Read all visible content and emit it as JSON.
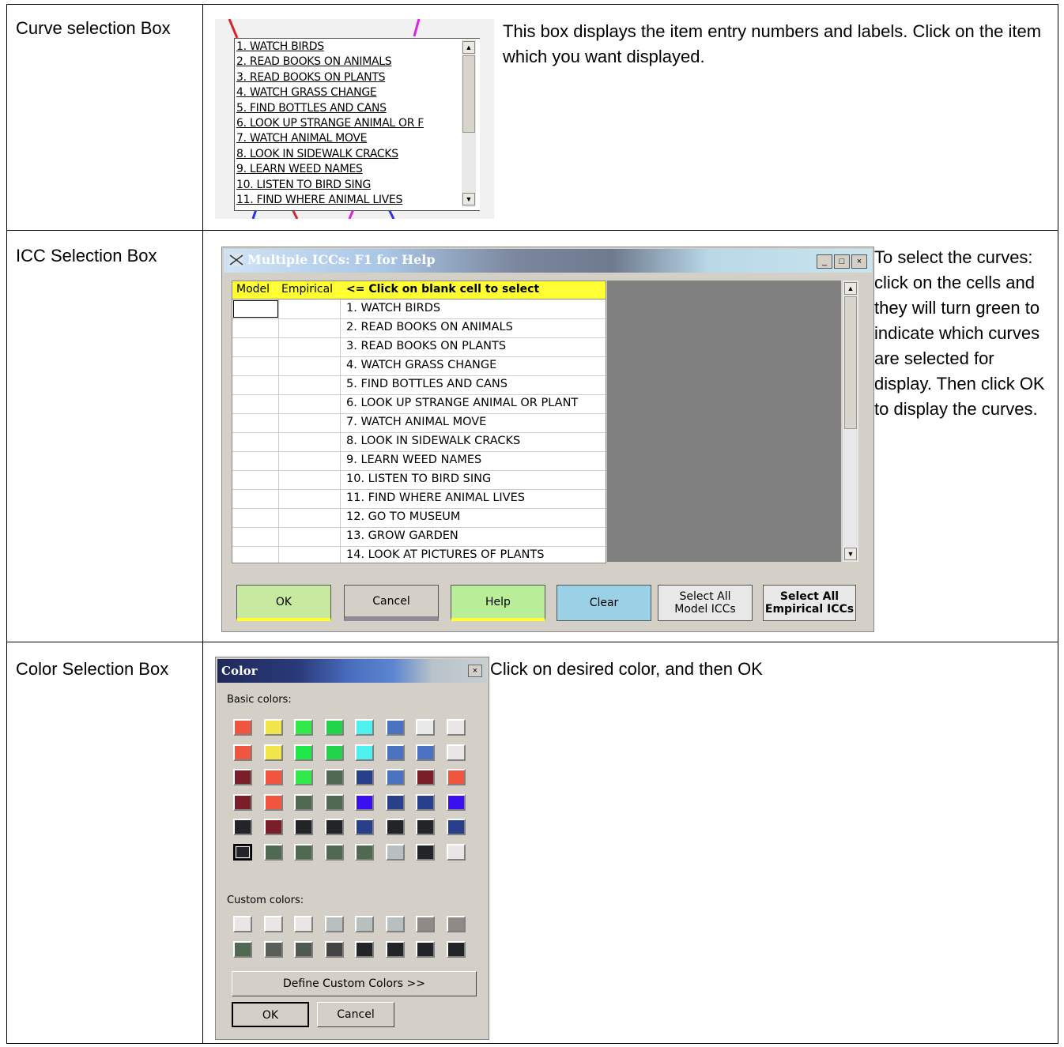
{
  "rows": [
    {
      "label": "Curve selection Box",
      "description": "This box displays the item entry numbers and labels. Click on the item which you want displayed."
    },
    {
      "label": "ICC Selection Box",
      "description": "To select the curves: click on the cells and they will turn green to indicate which curves are selected for display. Then click OK to display the curves."
    },
    {
      "label": "Color Selection Box",
      "description": "Click on desired color, and then OK"
    }
  ],
  "curve_list": {
    "items": [
      "1. WATCH BIRDS",
      "2. READ BOOKS ON ANIMALS",
      "3. READ BOOKS ON PLANTS",
      "4. WATCH GRASS CHANGE",
      "5. FIND BOTTLES AND CANS",
      "6. LOOK UP STRANGE ANIMAL OR F",
      "7. WATCH ANIMAL MOVE",
      "8. LOOK IN SIDEWALK CRACKS",
      "9. LEARN WEED NAMES",
      "10. LISTEN TO BIRD SING",
      "11. FIND WHERE ANIMAL LIVES"
    ],
    "scroll_up": "▲",
    "scroll_down": "▼"
  },
  "icc_dialog": {
    "title": "Multiple ICCs: F1 for Help",
    "min": "_",
    "max": "□",
    "close": "×",
    "headers": {
      "model": "Model",
      "empirical": "Empirical",
      "instruction": "<= Click on blank cell to select"
    },
    "items": [
      "1. WATCH BIRDS",
      "2. READ BOOKS ON ANIMALS",
      "3. READ BOOKS ON PLANTS",
      "4. WATCH GRASS CHANGE",
      "5. FIND BOTTLES AND CANS",
      "6. LOOK UP STRANGE ANIMAL OR PLANT",
      "7. WATCH ANIMAL MOVE",
      "8. LOOK IN SIDEWALK CRACKS",
      "9. LEARN WEED NAMES",
      "10. LISTEN TO BIRD SING",
      "11. FIND WHERE ANIMAL LIVES",
      "12. GO TO MUSEUM",
      "13. GROW GARDEN",
      "14. LOOK AT PICTURES OF PLANTS"
    ],
    "buttons": {
      "ok": "OK",
      "cancel": "Cancel",
      "help": "Help",
      "clear": "Clear",
      "select_model_1": "Select All",
      "select_model_2": "Model ICCs",
      "select_emp_1": "Select All",
      "select_emp_2": "Empirical ICCs"
    },
    "colors": {
      "ok": "#c7e9a0",
      "help": "#b9ee99",
      "clear": "#9bd1e6",
      "header": "#ffff33",
      "plot": "#808080"
    }
  },
  "color_dialog": {
    "title": "Color",
    "close": "×",
    "basic_label": "Basic colors:",
    "custom_label": "Custom colors:",
    "define_button": "Define Custom Colors >>",
    "ok": "OK",
    "cancel": "Cancel",
    "basic_colors": [
      [
        "#f0553f",
        "#f0e64a",
        "#33e84a",
        "#21d449",
        "#4ff0f0",
        "#4a72c0",
        "#e8e8e8",
        "#ebe6e6"
      ],
      [
        "#f0553f",
        "#f0e64a",
        "#21e84a",
        "#21d449",
        "#4ff0f0",
        "#4a72c0",
        "#4a72c0",
        "#ebe6e6"
      ],
      [
        "#7a1f2a",
        "#f0553f",
        "#33e84a",
        "#4f6a50",
        "#283f8c",
        "#4a72c0",
        "#7a1f2a",
        "#f0553f"
      ],
      [
        "#7a1f2a",
        "#f0553f",
        "#4f6a50",
        "#4f6a50",
        "#3a10f0",
        "#283f8c",
        "#283f8c",
        "#3a10f0"
      ],
      [
        "#222428",
        "#7a1f2a",
        "#222428",
        "#222428",
        "#283f8c",
        "#222428",
        "#222428",
        "#283f8c"
      ],
      [
        "#222428",
        "#4f6a50",
        "#4f6a50",
        "#4f6a50",
        "#4f6a50",
        "#b8c0bf",
        "#222428",
        "#ebe6e6"
      ]
    ],
    "custom_colors": [
      [
        "#ebe6e6",
        "#ebe6e6",
        "#ebe6e6",
        "#b8c0bf",
        "#b8c0bf",
        "#b8c0bf",
        "#8f8a86",
        "#8f8a86"
      ],
      [
        "#4f6a50",
        "#5a5e58",
        "#4f5a50",
        "#444444",
        "#222428",
        "#222428",
        "#222428",
        "#222428"
      ]
    ]
  }
}
